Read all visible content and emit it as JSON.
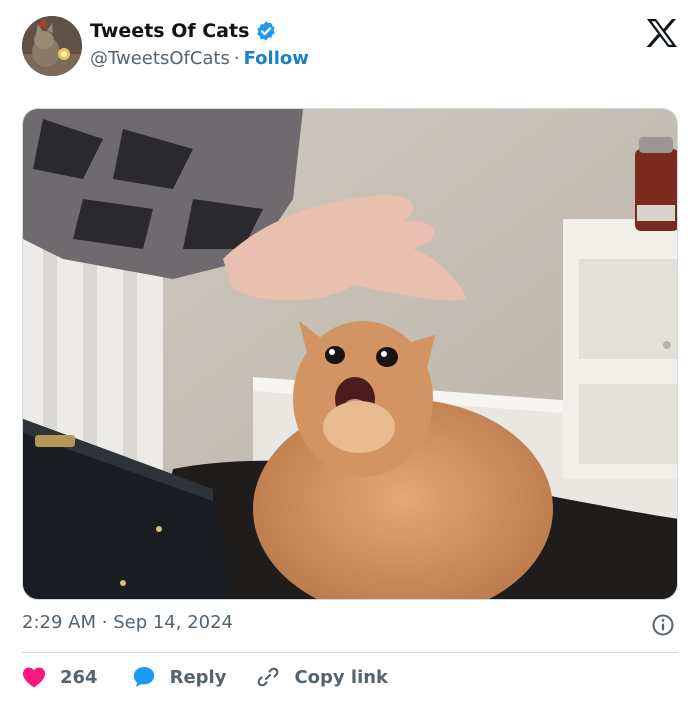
{
  "author": {
    "name": "Tweets Of Cats",
    "handle": "@TweetsOfCats",
    "separator": "·",
    "follow_label": "Follow",
    "verified_icon": "verified-badge-icon",
    "avatar_icon": "avatar-cat-photo"
  },
  "brand": {
    "logo_icon": "x-logo-icon"
  },
  "timestamp": {
    "time": "2:29 AM",
    "separator": "·",
    "date": "Sep 14, 2024"
  },
  "actions": {
    "like_count": "264",
    "reply_label": "Reply",
    "copy_label": "Copy link"
  },
  "colors": {
    "accent": "#1d9bf0",
    "follow": "#1d7fc9",
    "like": "#f91880",
    "muted": "#536471",
    "divider": "#cfd9de"
  }
}
